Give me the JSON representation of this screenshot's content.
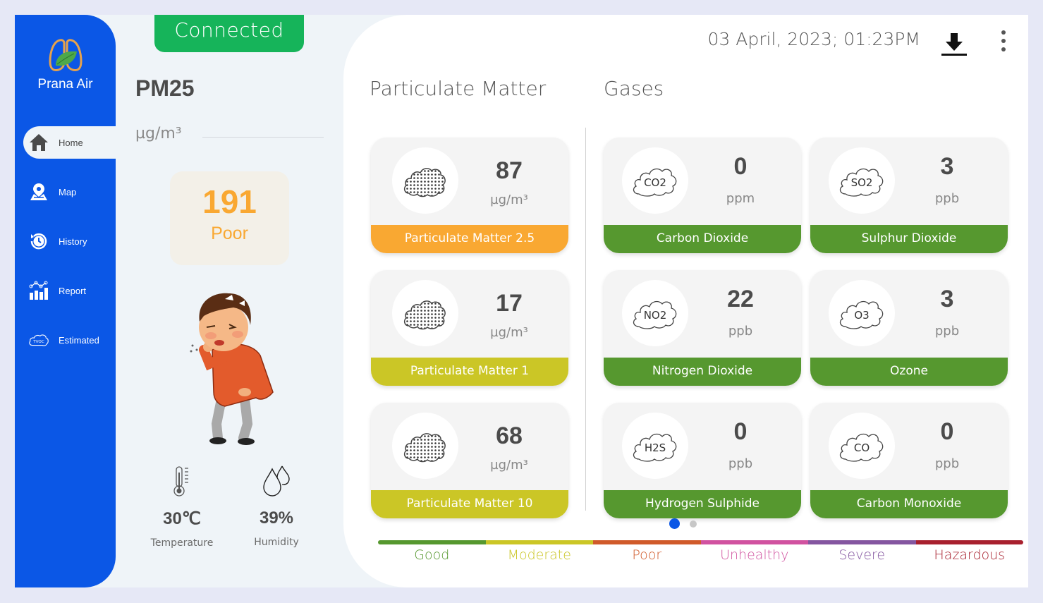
{
  "app": {
    "name": "Prana Air"
  },
  "sidebar": {
    "items": [
      {
        "label": "Home",
        "icon": "home-icon",
        "active": true
      },
      {
        "label": "Map",
        "icon": "map-pin-icon",
        "active": false
      },
      {
        "label": "History",
        "icon": "history-icon",
        "active": false
      },
      {
        "label": "Report",
        "icon": "report-chart-icon",
        "active": false
      },
      {
        "label": "Estimated",
        "icon": "tvoc-cloud-icon",
        "active": false
      }
    ]
  },
  "status": {
    "connection": "Connected",
    "color": "#16b45a"
  },
  "left_panel": {
    "pollutant": "PM25",
    "unit": "µg/m³",
    "aqi_value": "191",
    "aqi_status": "Poor",
    "aqi_color": "#f9a832",
    "temperature": {
      "value": "30℃",
      "label": "Temperature"
    },
    "humidity": {
      "value": "39%",
      "label": "Humidity"
    }
  },
  "header": {
    "datetime": "03 April, 2023; 01:23PM",
    "download_icon": "download-icon",
    "more_icon": "more-vertical-icon"
  },
  "sections": {
    "particulate_title": "Particulate Matter",
    "gases_title": "Gases"
  },
  "particulate": [
    {
      "value": "87",
      "unit": "µg/m³",
      "name": "Particulate Matter 2.5",
      "color": "#f9a832"
    },
    {
      "value": "17",
      "unit": "µg/m³",
      "name": "Particulate Matter 1",
      "color": "#cbc626"
    },
    {
      "value": "68",
      "unit": "µg/m³",
      "name": "Particulate Matter 10",
      "color": "#cbc626"
    }
  ],
  "gases": [
    {
      "value": "0",
      "unit": "ppm",
      "name": "Carbon Dioxide",
      "symbol": "CO2",
      "color": "#56982f"
    },
    {
      "value": "3",
      "unit": "ppb",
      "name": "Sulphur Dioxide",
      "symbol": "SO2",
      "color": "#56982f"
    },
    {
      "value": "22",
      "unit": "ppb",
      "name": "Nitrogen Dioxide",
      "symbol": "NO2",
      "color": "#56982f"
    },
    {
      "value": "3",
      "unit": "ppb",
      "name": "Ozone",
      "symbol": "O3",
      "color": "#56982f"
    },
    {
      "value": "0",
      "unit": "ppb",
      "name": "Hydrogen Sulphide",
      "symbol": "H2S",
      "color": "#56982f"
    },
    {
      "value": "0",
      "unit": "ppb",
      "name": "Carbon Monoxide",
      "symbol": "CO",
      "color": "#56982f"
    }
  ],
  "pagination": {
    "pages": 2,
    "current": 1
  },
  "aqi_scale": [
    {
      "label": "Good",
      "color": "#56982f"
    },
    {
      "label": "Moderate",
      "color": "#cbc626"
    },
    {
      "label": "Poor",
      "color": "#d05a2a"
    },
    {
      "label": "Unhealthy",
      "color": "#d152a0"
    },
    {
      "label": "Severe",
      "color": "#8456a0"
    },
    {
      "label": "Hazardous",
      "color": "#a8202e"
    }
  ]
}
